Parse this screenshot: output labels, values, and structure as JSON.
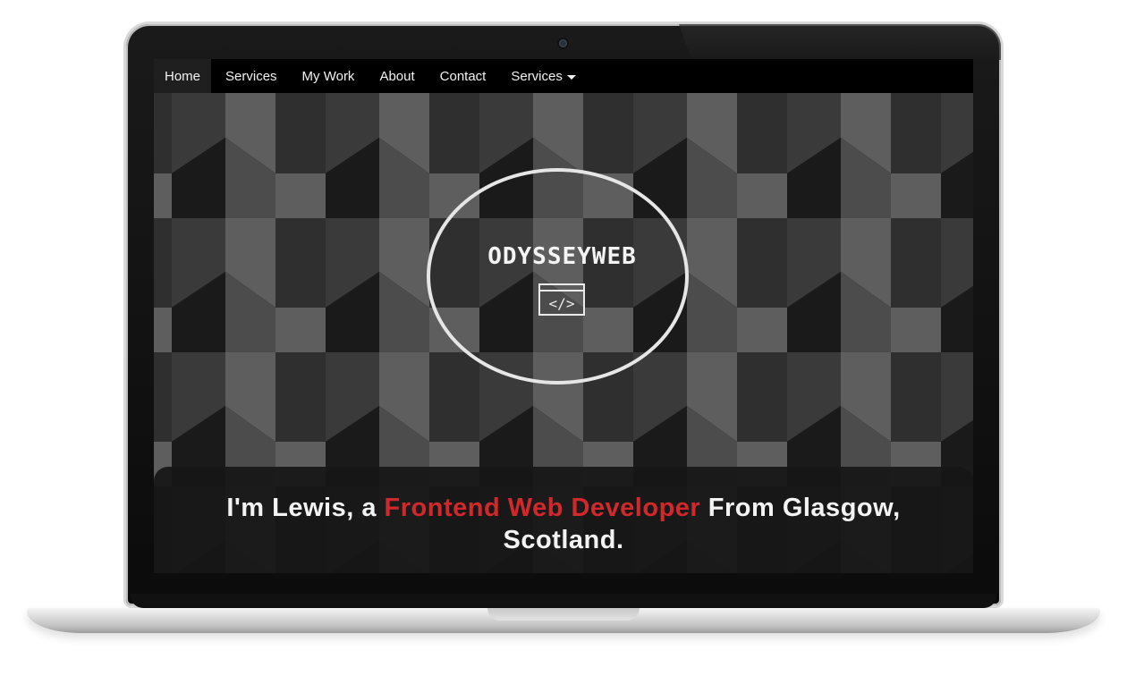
{
  "nav": {
    "items": [
      {
        "label": "Home",
        "active": true
      },
      {
        "label": "Services"
      },
      {
        "label": "My Work"
      },
      {
        "label": "About"
      },
      {
        "label": "Contact"
      }
    ],
    "dropdown": {
      "label": "Services",
      "icon": "caret-down-icon"
    }
  },
  "hero": {
    "brand": "ODYSSEYWEB",
    "brand_icon": "code-icon",
    "icon_text": "</>"
  },
  "tagline": {
    "prefix": "I'm Lewis, a ",
    "highlight": "Frontend Web Developer",
    "suffix": " From Glasgow, Scotland."
  },
  "colors": {
    "accent": "#d0282b",
    "background": "#000000",
    "pattern_light": "#5e5e5e",
    "pattern_dark": "#333333"
  }
}
